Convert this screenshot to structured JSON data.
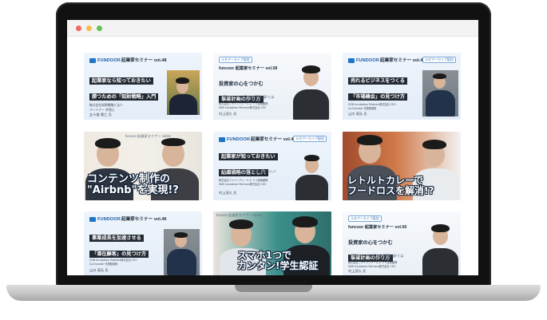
{
  "browser": {
    "dots": [
      "close",
      "minimize",
      "maximize"
    ]
  },
  "cards": [
    {
      "kind": "seminar",
      "logo": "FUNDOOR",
      "series": "起業家セミナー vol.48",
      "archive": "",
      "title_lines": [
        "起業家なら知っておきたい",
        "勝つための「知財戦略」入門"
      ],
      "sub": "",
      "speaker_org": "株式会社知財戦略と法人\nパートナー 弁理士",
      "speaker": "五十嵐 貴仁 氏"
    },
    {
      "kind": "seminar",
      "logo": "",
      "series": "funcoor 起業家セミナー vol.58",
      "archive": "ルセアーカイブ配信",
      "title_lines": [
        "投資家の心をつかむ",
        "事業計画の作り方"
      ],
      "sub": "〜 実践シナリオを伝える\"精緻計画\"とは",
      "speaker_org": "株式会社ファインディールス ドメ技術顧問\nSDB Incubation Partners株式会社 CEO",
      "speaker": "村上茂久 氏"
    },
    {
      "kind": "seminar",
      "logo": "FUNDOOR",
      "series": "起業家セミナー vol.45",
      "archive": "ルセアーカイブ配信",
      "title_lines": [
        "売れるビジネスをつくる",
        "「市場機会」の見つけ方"
      ],
      "sub": "",
      "speaker_org": "GOB Incubation Partners株式会社 CEO\nCo-Founder 代表取締役",
      "speaker": "山口 高弘 氏"
    },
    {
      "kind": "thumb",
      "series": "funcoor 起業家セミナー vol.64",
      "overlay_lines": [
        "コンテンツ制作の",
        "\"Airbnb\"を実現!?"
      ]
    },
    {
      "kind": "seminar",
      "logo": "FUNDOOR",
      "series": "起業家セミナー vol.44",
      "archive": "ルセアーカイブ配信",
      "title_lines": [
        "起業家が知っておきたい",
        "組織戦略の落とし穴"
      ],
      "sub": "〜 新規スタートアップから企業の課題について",
      "speaker_org": "株式会社ファインディールス ドメ技術顧問\nSDB Incubation Partners株式会社 CEO",
      "speaker": "村上茂久 氏"
    },
    {
      "kind": "thumb",
      "series": "",
      "overlay_lines": [
        "レトルトカレーで",
        "フードロスを解消!?"
      ]
    },
    {
      "kind": "seminar",
      "logo": "FUNDOOR",
      "series": "起業家セミナー vol.46",
      "archive": "",
      "title_lines": [
        "事業成長を加速させる",
        "「潜在顧客」の見つけ方"
      ],
      "sub": "",
      "speaker_org": "GOB Incubation Partners株式会社 CEO\nCo-Founder 代表取締役",
      "speaker": "山口 高弘 氏"
    },
    {
      "kind": "thumb",
      "series": "funcoor 起業家セミナー vol.60",
      "overlay_lines": [
        "スマホ1つで",
        "カンタン!学生認証"
      ]
    },
    {
      "kind": "seminar",
      "logo": "",
      "series": "funcoor 起業家セミナー vol.56",
      "archive": "ルセアーカイブ配信",
      "title_lines": [
        "投資家の心をつかむ",
        "事業計画の作り方"
      ],
      "sub": "〜 実践シナリオを伝える\"精緻計画\"とは",
      "speaker_org": "株式会社ファインディールス ドメ技術顧問\nSDB Incubation Partners株式会社 CEO",
      "speaker": "村上茂久 氏"
    }
  ],
  "colors": {
    "accent": "#1e74c6",
    "title_bg": "#232a33",
    "outline": "#12243b"
  }
}
